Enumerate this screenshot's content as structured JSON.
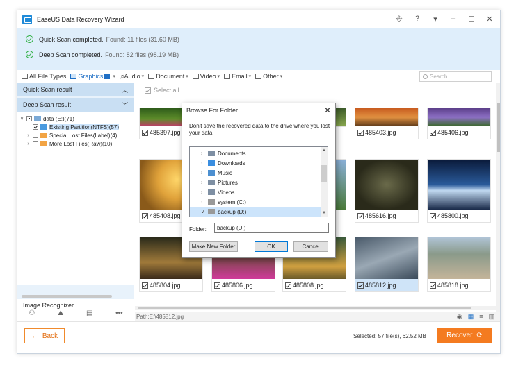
{
  "window": {
    "title": "EaseUS Data Recovery Wizard"
  },
  "titlebar_icons": [
    "sign-in-icon",
    "help-icon",
    "menu-icon",
    "minimize-icon",
    "maximize-icon",
    "close-icon"
  ],
  "status": {
    "quick": {
      "label": "Quick Scan completed.",
      "value": "Found: 11 files (31.60 MB)"
    },
    "deep": {
      "label": "Deep Scan completed.",
      "value": "Found: 82 files (98.19 MB)"
    }
  },
  "filters": [
    {
      "label": "All File Types"
    },
    {
      "label": "Graphics"
    },
    {
      "label": "Audio"
    },
    {
      "label": "Document"
    },
    {
      "label": "Video"
    },
    {
      "label": "Email"
    },
    {
      "label": "Other"
    }
  ],
  "search": {
    "placeholder": "Search"
  },
  "sidebar": {
    "quick_head": "Quick Scan result",
    "deep_head": "Deep Scan result",
    "tree": {
      "root": "data (E:)(71)",
      "existing": "Existing Partition(NTFS)(57)",
      "special": "Special Lost Files(Label)(4)",
      "more": "More Lost Files(Raw)(10)"
    },
    "image_recognizer": "Image Recognizer"
  },
  "grid": {
    "select_all": "Select all",
    "files": [
      {
        "name": "485397.jpg"
      },
      {
        "name": ""
      },
      {
        "name": ""
      },
      {
        "name": "485403.jpg"
      },
      {
        "name": "485406.jpg"
      },
      {
        "name": "485408.jpg"
      },
      {
        "name": ""
      },
      {
        "name": ""
      },
      {
        "name": "485616.jpg"
      },
      {
        "name": "485800.jpg"
      },
      {
        "name": "485804.jpg"
      },
      {
        "name": "485806.jpg"
      },
      {
        "name": "485808.jpg"
      },
      {
        "name": "485812.jpg"
      },
      {
        "name": "485818.jpg"
      }
    ]
  },
  "pathbar": {
    "path": "Path:E:\\485812.jpg"
  },
  "bottom": {
    "back": "Back",
    "selected": "Selected: 57 file(s), 62.52 MB",
    "recover": "Recover"
  },
  "dialog": {
    "title": "Browse For Folder",
    "message": "Don't save the recovered data to the drive where you lost your data.",
    "items": [
      "Documents",
      "Downloads",
      "Music",
      "Pictures",
      "Videos",
      "system (C:)",
      "backup (D:)"
    ],
    "folder_label": "Folder:",
    "folder_value": "backup (D:)",
    "make_new": "Make New Folder",
    "ok": "OK",
    "cancel": "Cancel"
  },
  "colors": {
    "accent": "#1f6fc5",
    "orange": "#f47b20",
    "status_bg": "#dfeefb",
    "ok_green": "#36b24a"
  }
}
